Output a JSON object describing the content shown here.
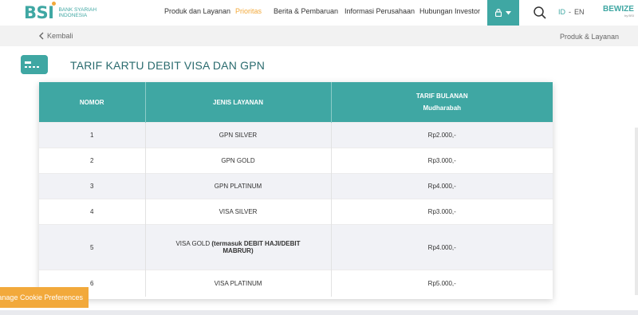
{
  "brand": {
    "logo_text": "BSI",
    "logo_sub": "BANK SYARIAH INDONESIA"
  },
  "nav": {
    "items": [
      "Produk dan Layanan",
      "Prioritas",
      "Berita & Pembaruan",
      "Informasi Perusahaan",
      "Hubungan Investor"
    ],
    "active": "Prioritas",
    "lang_id": "ID",
    "lang_sep": "-",
    "lang_en": "EN",
    "bewize": "BEWIZE",
    "bewize_sub": "by BSI"
  },
  "breadcrumb": {
    "back_label": "Kembali",
    "current": "Produk & Layanan"
  },
  "page": {
    "title": "TARIF KARTU DEBIT VISA DAN GPN"
  },
  "table": {
    "headers": {
      "col1": "NOMOR",
      "col2": "JENIS LAYANAN",
      "col3_line1": "TARIF BULANAN",
      "col3_line2": "Mudharabah"
    },
    "rows": [
      {
        "no": "1",
        "service": "GPN SILVER",
        "fee": "Rp2.000,-"
      },
      {
        "no": "2",
        "service": "GPN GOLD",
        "fee": "Rp3.000,-"
      },
      {
        "no": "3",
        "service": "GPN PLATINUM",
        "fee": "Rp4.000,-"
      },
      {
        "no": "4",
        "service": "VISA SILVER",
        "fee": "Rp3.000,-"
      },
      {
        "no": "5",
        "service_prefix": "VISA GOLD ",
        "service_bold": "(termasuk DEBIT HAJI/DEBIT MABRUR)",
        "fee": "Rp4.000,-"
      },
      {
        "no": "6",
        "service": "VISA PLATINUM",
        "fee": "Rp5.000,-"
      }
    ]
  },
  "cookie": {
    "label": "Manage Cookie Preferences"
  },
  "colors": {
    "accent": "#3fa7a3",
    "highlight": "#f2a93b",
    "title": "#2a6b6e"
  }
}
